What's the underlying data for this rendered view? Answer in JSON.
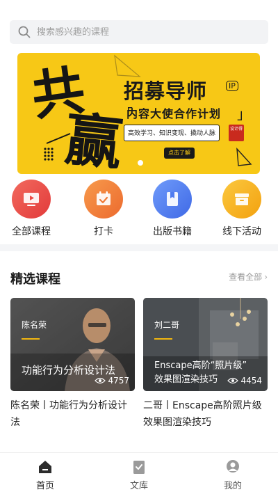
{
  "search": {
    "placeholder": "搜索感兴趣的课程"
  },
  "banner": {
    "calligraphy": "共赢",
    "title": "招募导师",
    "ip_badge": "IP",
    "subtitle": "内容大使合作计划",
    "bracket_open": "「",
    "bracket_close": "」",
    "tags": "高效学习、知识变现、撬动人脉",
    "badge": "设计得",
    "cta": "点击了解"
  },
  "nav": [
    {
      "label": "全部课程",
      "icon": "play-icon",
      "color": "#ec4a45"
    },
    {
      "label": "打卡",
      "icon": "calendar-check-icon",
      "color": "#f07a36"
    },
    {
      "label": "出版书籍",
      "icon": "book-icon",
      "color": "#4f7cf0"
    },
    {
      "label": "线下活动",
      "icon": "archive-box-icon",
      "color": "#f7b01c"
    }
  ],
  "section": {
    "title": "精选课程",
    "view_all": "查看全部"
  },
  "courses": [
    {
      "thumb_name": "陈名荣",
      "thumb_title": "功能行为分析设计法",
      "views": "4757",
      "caption": "陈名荣丨功能行为分析设计法"
    },
    {
      "thumb_name": "刘二哥",
      "thumb_title_line1": "Enscape高阶“照片级”",
      "thumb_title_line2": "效果图渲染技巧",
      "views": "4454",
      "caption": "二哥丨Enscape高阶照片级 效果图渲染技巧"
    }
  ],
  "tabs": [
    {
      "label": "首页",
      "active": true
    },
    {
      "label": "文库",
      "active": false
    },
    {
      "label": "我的",
      "active": false
    }
  ]
}
